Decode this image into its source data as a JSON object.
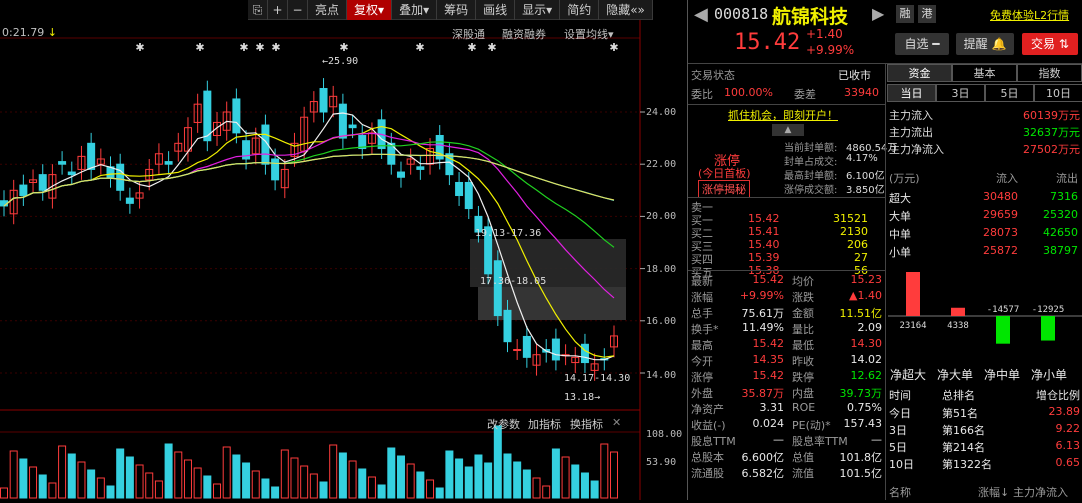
{
  "toolbar": {
    "items": [
      "亮点",
      "复权",
      "叠加",
      "筹码",
      "画线",
      "显示",
      "简约",
      "隐藏"
    ],
    "collapse_icon": "«»"
  },
  "top_left": {
    "time": "0:21.79"
  },
  "top_links": [
    "深股通",
    "融资融券",
    "设置均线"
  ],
  "price_axis": [
    "24.00",
    "22.00",
    "20.00",
    "18.00",
    "16.00",
    "14.00"
  ],
  "vol_axis": [
    "108.00",
    "53.90"
  ],
  "annotations": {
    "high": "25.90",
    "low": "13.18",
    "zone1": "19.13-17.36",
    "zone2": "17.36-18.05",
    "zone3": "14.17-14.30"
  },
  "volume_buttons": [
    "改参数",
    "加指标",
    "换指标"
  ],
  "stock": {
    "code": "000818",
    "name": "航锦科技",
    "price": "15.42",
    "change": "+1.40",
    "pct": "+9.99%",
    "tag1": "融",
    "tag2": "港",
    "l2": "免费体验L2行情"
  },
  "actions": {
    "watch": "自选",
    "remind": "提醒",
    "trade": "交易"
  },
  "status": {
    "label": "交易状态",
    "value": "已收市"
  },
  "weibi": {
    "l1": "委比",
    "v1": "100.00%",
    "l2": "委差",
    "v2": "33940"
  },
  "promo": "抓住机会，即刻开户！",
  "limit": {
    "title": "涨停",
    "sub": "(今日首板)",
    "reveal": "涨停揭秘",
    "rows": [
      [
        "当前封单额:",
        "4860.54万"
      ],
      [
        "封单占成交:",
        "4.17%"
      ],
      [
        "最高封单额:",
        "6.100亿"
      ],
      [
        "涨停成交额:",
        "3.850亿"
      ]
    ]
  },
  "book": [
    [
      "卖一",
      "",
      ""
    ],
    [
      "买一",
      "15.42",
      "31521"
    ],
    [
      "买二",
      "15.41",
      "2130"
    ],
    [
      "买三",
      "15.40",
      "206"
    ],
    [
      "买四",
      "15.39",
      "27"
    ],
    [
      "买五",
      "15.38",
      "56"
    ]
  ],
  "quote": [
    [
      "最新",
      "15.42",
      "均价",
      "15.23"
    ],
    [
      "涨幅",
      "+9.99%",
      "涨跌",
      "▲1.40"
    ],
    [
      "总手",
      "75.61万",
      "金额",
      "11.51亿"
    ],
    [
      "换手*",
      "11.49%",
      "量比",
      "2.09"
    ],
    [
      "最高",
      "15.42",
      "最低",
      "14.30"
    ],
    [
      "今开",
      "14.35",
      "昨收",
      "14.02"
    ],
    [
      "涨停",
      "15.42",
      "跌停",
      "12.62"
    ],
    [
      "外盘",
      "35.87万",
      "内盘",
      "39.73万"
    ],
    [
      "净资产",
      "3.31",
      "ROE",
      "0.75%"
    ],
    [
      "收益(-)",
      "0.024",
      "PE(动)*",
      "157.43"
    ],
    [
      "股息TTM",
      "—",
      "股息率TTM",
      "—"
    ],
    [
      "总股本",
      "6.600亿",
      "总值",
      "101.8亿"
    ],
    [
      "流通股",
      "6.582亿",
      "流值",
      "101.5亿"
    ]
  ],
  "fund_tabs": [
    "资金",
    "基本",
    "指数"
  ],
  "period_tabs": [
    "当日",
    "3日",
    "5日",
    "10日"
  ],
  "flow": [
    [
      "主力流入",
      "60139万元"
    ],
    [
      "主力流出",
      "32637万元"
    ],
    [
      "主力净流入",
      "27502万元"
    ]
  ],
  "flow_table": {
    "head": [
      "(万元)",
      "流入",
      "流出"
    ],
    "rows": [
      [
        "超大",
        "30480",
        "7316"
      ],
      [
        "大单",
        "29659",
        "25320"
      ],
      [
        "中单",
        "28073",
        "42650"
      ],
      [
        "小单",
        "25872",
        "38797"
      ]
    ]
  },
  "net_bars": {
    "values": [
      23164,
      4338,
      -14577,
      -12925
    ],
    "labels": [
      "净超大",
      "净大单",
      "净中单",
      "净小单"
    ]
  },
  "rank": {
    "head": [
      "时间",
      "总排名",
      "增仓比例"
    ],
    "rows": [
      [
        "今日",
        "第51名",
        "23.89"
      ],
      [
        "3日",
        "第166名",
        "9.22"
      ],
      [
        "5日",
        "第214名",
        "6.13"
      ],
      [
        "10日",
        "第1322名",
        "0.65"
      ]
    ]
  },
  "bottom": [
    "名称",
    "涨幅↓",
    "主力净流入"
  ]
}
